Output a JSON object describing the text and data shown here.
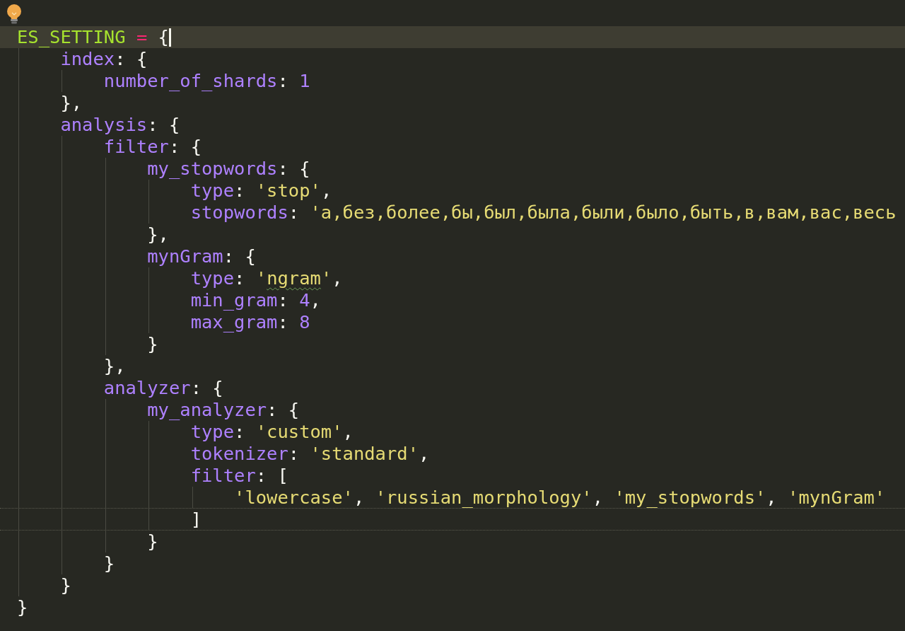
{
  "editor": {
    "lines": [
      {
        "current": true,
        "tokens": [
          {
            "kind": "variable",
            "text": "ES_SETTING"
          },
          {
            "kind": "operator",
            "text": " ="
          },
          {
            "kind": "punct",
            "text": " {"
          }
        ],
        "children": [
          {
            "current": false,
            "tokens": [
              {
                "kind": "key",
                "text": "index"
              },
              {
                "kind": "punct",
                "text": ": {"
              }
            ],
            "children": [
              {
                "current": false,
                "tokens": [
                  {
                    "kind": "key",
                    "text": "number_of_shards"
                  },
                  {
                    "kind": "punct",
                    "text": ":"
                  },
                  {
                    "kind": "number",
                    "text": " 1"
                  }
                ]
              }
            ]
          },
          {
            "current": false,
            "tokens": [
              {
                "kind": "punct",
                "text": "},"
              }
            ]
          },
          {
            "current": false,
            "tokens": [
              {
                "kind": "key",
                "text": "analysis"
              },
              {
                "kind": "punct",
                "text": ": {"
              }
            ],
            "children": [
              {
                "current": false,
                "tokens": [
                  {
                    "kind": "key",
                    "text": "filter"
                  },
                  {
                    "kind": "punct",
                    "text": ": {"
                  }
                ],
                "children": [
                  {
                    "current": false,
                    "tokens": [
                      {
                        "kind": "key",
                        "text": "my_stopwords"
                      },
                      {
                        "kind": "punct",
                        "text": ": {"
                      }
                    ],
                    "children": [
                      {
                        "current": false,
                        "tokens": [
                          {
                            "kind": "key",
                            "text": "type"
                          },
                          {
                            "kind": "punct",
                            "text": ":"
                          },
                          {
                            "kind": "string",
                            "text": " 'stop'"
                          },
                          {
                            "kind": "punct",
                            "text": ","
                          }
                        ]
                      },
                      {
                        "current": false,
                        "tokens": [
                          {
                            "kind": "key",
                            "text": "stopwords"
                          },
                          {
                            "kind": "punct",
                            "text": ":"
                          },
                          {
                            "kind": "string",
                            "text": " 'а,без,более,бы,был,была,были,было,быть,в,вам,вас,весь"
                          }
                        ]
                      }
                    ]
                  },
                  {
                    "current": false,
                    "tokens": [
                      {
                        "kind": "punct",
                        "text": "},"
                      }
                    ]
                  },
                  {
                    "current": false,
                    "tokens": [
                      {
                        "kind": "key",
                        "text": "mynGram"
                      },
                      {
                        "kind": "punct",
                        "text": ": {"
                      }
                    ],
                    "children": [
                      {
                        "current": false,
                        "tokens": [
                          {
                            "kind": "key",
                            "text": "type"
                          },
                          {
                            "kind": "punct",
                            "text": ":"
                          },
                          {
                            "kind": "string",
                            "text": " '"
                          },
                          {
                            "kind": "string",
                            "text": "ngram",
                            "misspelled": true
                          },
                          {
                            "kind": "string",
                            "text": "'"
                          },
                          {
                            "kind": "punct",
                            "text": ","
                          }
                        ]
                      },
                      {
                        "current": false,
                        "tokens": [
                          {
                            "kind": "key",
                            "text": "min_gram"
                          },
                          {
                            "kind": "punct",
                            "text": ":"
                          },
                          {
                            "kind": "number",
                            "text": " 4"
                          },
                          {
                            "kind": "punct",
                            "text": ","
                          }
                        ]
                      },
                      {
                        "current": false,
                        "tokens": [
                          {
                            "kind": "key",
                            "text": "max_gram"
                          },
                          {
                            "kind": "punct",
                            "text": ":"
                          },
                          {
                            "kind": "number",
                            "text": " 8"
                          }
                        ]
                      }
                    ]
                  },
                  {
                    "current": false,
                    "tokens": [
                      {
                        "kind": "punct",
                        "text": "}"
                      }
                    ]
                  }
                ]
              },
              {
                "current": false,
                "tokens": [
                  {
                    "kind": "punct",
                    "text": "},"
                  }
                ]
              },
              {
                "current": false,
                "tokens": [
                  {
                    "kind": "key",
                    "text": "analyzer"
                  },
                  {
                    "kind": "punct",
                    "text": ": {"
                  }
                ],
                "children": [
                  {
                    "current": false,
                    "tokens": [
                      {
                        "kind": "key",
                        "text": "my_analyzer"
                      },
                      {
                        "kind": "punct",
                        "text": ": {"
                      }
                    ],
                    "children": [
                      {
                        "current": false,
                        "tokens": [
                          {
                            "kind": "key",
                            "text": "type"
                          },
                          {
                            "kind": "punct",
                            "text": ":"
                          },
                          {
                            "kind": "string",
                            "text": " 'custom'"
                          },
                          {
                            "kind": "punct",
                            "text": ","
                          }
                        ]
                      },
                      {
                        "current": false,
                        "tokens": [
                          {
                            "kind": "key",
                            "text": "tokenizer"
                          },
                          {
                            "kind": "punct",
                            "text": ":"
                          },
                          {
                            "kind": "string",
                            "text": " 'standard'"
                          },
                          {
                            "kind": "punct",
                            "text": ","
                          }
                        ]
                      },
                      {
                        "current": false,
                        "tokens": [
                          {
                            "kind": "key",
                            "text": "filter"
                          },
                          {
                            "kind": "punct",
                            "text": ": ["
                          }
                        ],
                        "children": [
                          {
                            "current": false,
                            "warning": true,
                            "tokens": [
                              {
                                "kind": "string",
                                "text": "'lowercase'"
                              },
                              {
                                "kind": "punct",
                                "text": ","
                              },
                              {
                                "kind": "string",
                                "text": " 'russian_morphology'"
                              },
                              {
                                "kind": "punct",
                                "text": ","
                              },
                              {
                                "kind": "string",
                                "text": " 'my_stopwords'"
                              },
                              {
                                "kind": "punct",
                                "text": ","
                              },
                              {
                                "kind": "string",
                                "text": " 'mynGram'"
                              }
                            ]
                          }
                        ]
                      },
                      {
                        "current": false,
                        "warning": true,
                        "tokens": [
                          {
                            "kind": "punct",
                            "text": "]"
                          }
                        ]
                      }
                    ]
                  },
                  {
                    "current": false,
                    "tokens": [
                      {
                        "kind": "punct",
                        "text": "}"
                      }
                    ]
                  }
                ]
              },
              {
                "current": false,
                "tokens": [
                  {
                    "kind": "punct",
                    "text": "}"
                  }
                ]
              }
            ]
          },
          {
            "current": false,
            "tokens": [
              {
                "kind": "punct",
                "text": "}"
              }
            ]
          }
        ]
      },
      {
        "current": false,
        "tokens": [
          {
            "kind": "punct",
            "text": "}"
          }
        ]
      }
    ]
  }
}
